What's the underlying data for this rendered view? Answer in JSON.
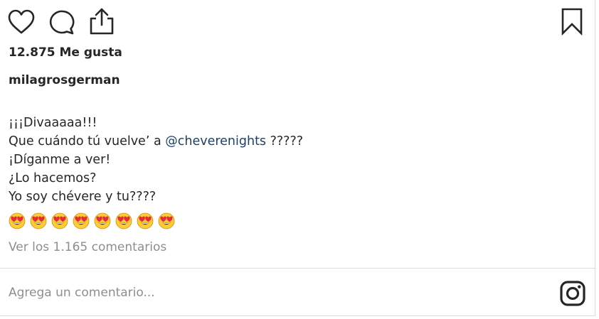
{
  "actions": {
    "like_icon": "heart-outline",
    "comment_icon": "speech-bubble-outline",
    "share_icon": "share-upload-arrow",
    "save_icon": "bookmark-outline"
  },
  "post": {
    "likes_text": "12.875 Me gusta",
    "username": "milagrosgerman",
    "caption": {
      "line1": "¡¡¡Divaaaaa!!!",
      "line2_prefix": "Que cuándo tú vuelve’ a ",
      "line2_mention": "@cheverenights",
      "line2_suffix": " ?????",
      "line3": "¡Díganme a ver!",
      "line4": "¿Lo hacemos?",
      "line5": "Yo soy chévere y tu????",
      "emoji_name": "heart-eyes-emoji",
      "emoji_count": 8
    },
    "view_comments": "Ver los 1.165 comentarios"
  },
  "comment_box": {
    "placeholder": "Agrega un comentario...",
    "camera_icon": "instagram-camera"
  },
  "colors": {
    "text": "#262626",
    "muted": "#8e8e8e",
    "mention": "#1f3f66",
    "divider": "#dbdbdb",
    "emoji_face": "#ffcc33",
    "emoji_hearts": "#e8293b"
  }
}
